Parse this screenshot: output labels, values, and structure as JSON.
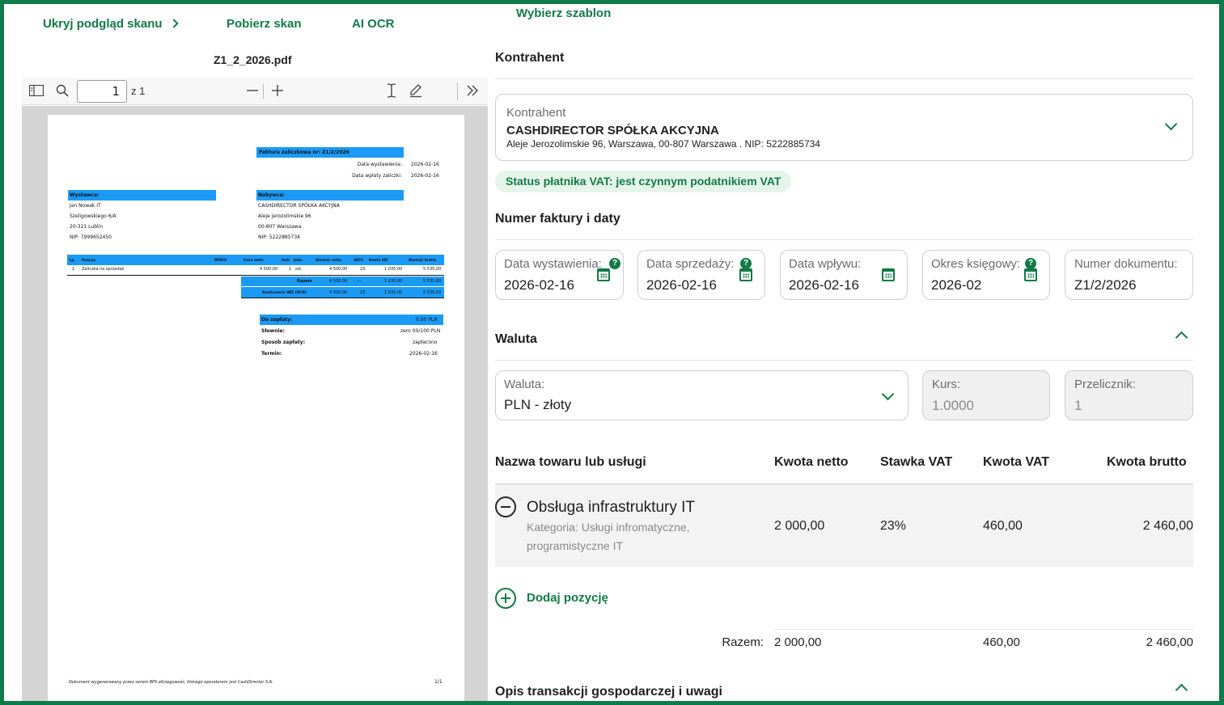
{
  "toolbar_links": {
    "hide_preview": "Ukryj podgląd skanu",
    "download": "Pobierz skan",
    "ai_ocr": "AI OCR",
    "choose_template": "Wybierz szablon"
  },
  "pdf": {
    "filename": "Z1_2_2026.pdf",
    "page_current": "1",
    "page_count": "z 1",
    "doc": {
      "title": "Faktura zaliczkowa nr: Z1/2/2026",
      "issue_label": "Data wystawienia:",
      "issue_value": "2026-02-16",
      "payment_label": "Data wpłaty zaliczki:",
      "payment_value": "2026-02-16",
      "seller_header": "Wystawca:",
      "seller_lines": [
        "Jan Nowak IT",
        "Szeligowskiego 6/A",
        "20-321 Lublin",
        "NIP: 7999652450"
      ],
      "buyer_header": "Nabywca:",
      "buyer_lines": [
        "CASHDIRECTOR SPÓŁKA AKCYJNA",
        "Aleje Jerozolimskie 96",
        "00-807 Warszawa",
        "NIP: 5222885734"
      ],
      "table_headers": [
        "Lp.",
        "Pozycja",
        "PKWiU",
        "Cena netto",
        "Ilość",
        "Jedn.",
        "Wartość netto",
        "VAT%",
        "Kwota VAT",
        "Wartość brutto"
      ],
      "row": [
        "1",
        "Zaliczka na sprzedaż",
        "",
        "4 500,00",
        "1",
        "szt.",
        "4 500,00",
        "23",
        "1 035,00",
        "5 535,00"
      ],
      "razem_label": "Razem",
      "razem_values": [
        "4 500,00",
        "---",
        "1 035,00",
        "5 535,00"
      ],
      "rozliczenie_label": "Rozliczenie VAT (PLN)",
      "rozliczenie_values": [
        "4 500,00",
        "23",
        "1 035,00",
        "5 535,00"
      ],
      "do_zaplaty_label": "Do zapłaty:",
      "do_zaplaty_value": "0,00 PLN",
      "slownie_label": "Słownie:",
      "slownie_value": "zero 00/100 PLN",
      "sposob_label": "Sposób zapłaty:",
      "sposob_value": "zapłacono",
      "termin_label": "Termin:",
      "termin_value": "2026-02-16",
      "footer": "Dokument wygenerowany przez serwis BPS eKsięgowość, którego operatorem jest CashDirector S.A.",
      "page_num": "1/1"
    }
  },
  "form": {
    "contractor_section": "Kontrahent",
    "contractor_label": "Kontrahent",
    "contractor_name": "CASHDIRECTOR SPÓŁKA AKCYJNA",
    "contractor_address": "Aleje Jerozolimskie 96, Warszawa, 00-807 Warszawa . NIP: 5222885734",
    "vat_status": "Status płatnika VAT: jest czynnym podatnikiem VAT",
    "dates_section": "Numer faktury i daty",
    "dates": [
      {
        "label": "Data wystawienia:",
        "value": "2026-02-16"
      },
      {
        "label": "Data sprzedaży:",
        "value": "2026-02-16"
      },
      {
        "label": "Data wpływu:",
        "value": "2026-02-16"
      },
      {
        "label": "Okres księgowy:",
        "value": "2026-02"
      },
      {
        "label": "Numer dokumentu:",
        "value": "Z1/2/2026"
      }
    ],
    "currency_section": "Waluta",
    "currency_label": "Waluta:",
    "currency_value": "PLN - złoty",
    "rate_label": "Kurs:",
    "rate_value": "1.0000",
    "converter_label": "Przelicznik:",
    "converter_value": "1",
    "items_headers": {
      "name": "Nazwa towaru lub usługi",
      "net": "Kwota netto",
      "vat_rate": "Stawka VAT",
      "vat": "Kwota VAT",
      "gross": "Kwota brutto"
    },
    "item": {
      "name": "Obsługa infrastruktury IT",
      "category": "Kategoria: Usługi infromatyczne, programistyczne IT",
      "category_line1": "Kategoria: Usługi infromatyczne,",
      "category_line2": "programistyczne IT",
      "net": "2 000,00",
      "vat_rate": "23%",
      "vat": "460,00",
      "gross": "2 460,00"
    },
    "add_item": "Dodaj pozycję",
    "totals": {
      "label": "Razem:",
      "net": "2 000,00",
      "vat": "460,00",
      "gross": "2 460,00"
    },
    "description_section": "Opis transakcji gospodarczej i uwagi"
  }
}
